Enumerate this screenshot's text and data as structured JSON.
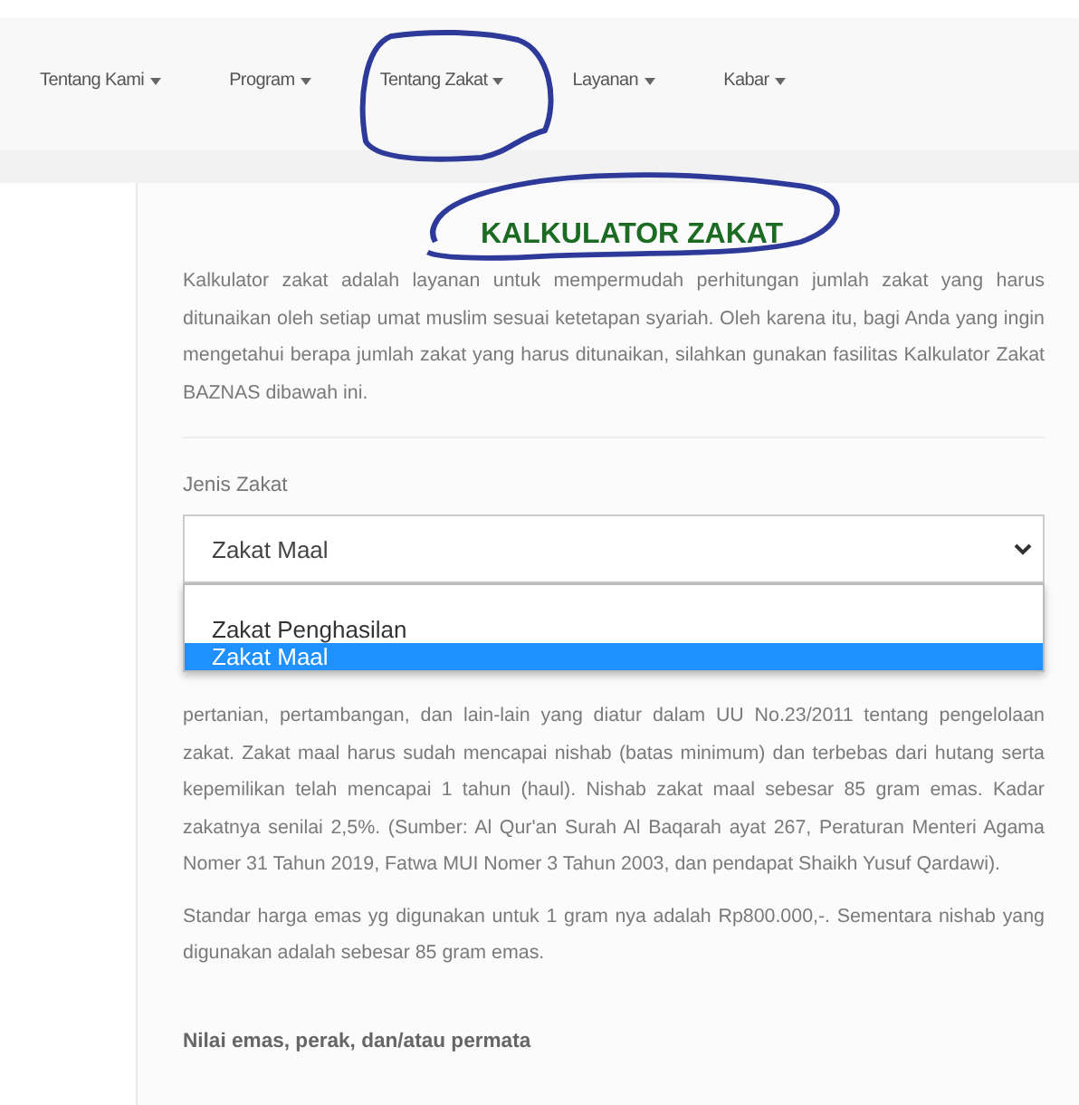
{
  "nav": {
    "items": [
      {
        "label": "Tentang Kami"
      },
      {
        "label": "Program"
      },
      {
        "label": "Tentang Zakat"
      },
      {
        "label": "Layanan"
      },
      {
        "label": "Kabar"
      }
    ]
  },
  "title": "KALKULATOR ZAKAT",
  "intro": "Kalkulator zakat adalah layanan untuk mempermudah perhitungan jumlah zakat yang harus ditunaikan oleh setiap umat muslim sesuai ketetapan syariah. Oleh karena itu, bagi Anda yang ingin mengetahui berapa jumlah zakat yang harus ditunaikan, silahkan gunakan fasilitas Kalkulator Zakat BAZNAS dibawah ini.",
  "zakat_type": {
    "label": "Jenis Zakat",
    "value": "Zakat Maal",
    "options": [
      {
        "label": "Zakat Penghasilan",
        "selected": false
      },
      {
        "label": "Zakat Maal",
        "selected": true
      }
    ]
  },
  "description": "pertanian, pertambangan, dan lain-lain yang diatur dalam UU No.23/2011 tentang pengelolaan zakat. Zakat maal harus sudah mencapai nishab (batas minimum) dan terbebas dari hutang serta kepemilikan telah mencapai 1 tahun (haul). Nishab zakat maal sebesar 85 gram emas. Kadar zakatnya senilai 2,5%. (Sumber: Al Qur'an Surah Al Baqarah ayat 267, Peraturan Menteri Agama Nomer 31 Tahun 2019, Fatwa MUI Nomer 3 Tahun 2003, dan pendapat Shaikh Yusuf Qardawi).",
  "price_note": "Standar harga emas yg digunakan untuk 1 gram nya adalah Rp800.000,-. Sementara nishab yang digunakan adalah sebesar 85 gram emas.",
  "section_heading": "Nilai emas, perak, dan/atau permata"
}
